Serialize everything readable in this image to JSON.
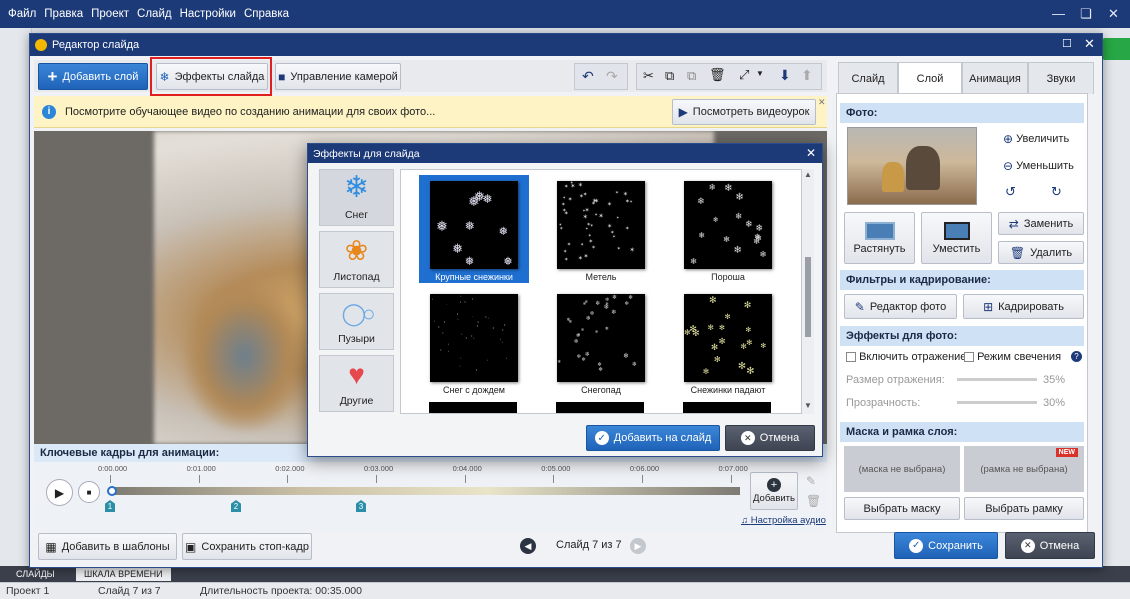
{
  "menubar": [
    "Файл",
    "Правка",
    "Проект",
    "Слайд",
    "Настройки",
    "Справка"
  ],
  "dialog": {
    "title": "Редактор слайда",
    "toolbar": {
      "add_layer": "Добавить слой",
      "slide_effects": "Эффекты слайда",
      "camera": "Управление камерой"
    },
    "hint": {
      "text": "Посмотрите обучающее видео по созданию анимации для своих фото...",
      "button": "Посмотреть видеоурок"
    },
    "timeline": {
      "header": "Ключевые кадры для анимации:",
      "ticks": [
        "0:00.000",
        "0:01.000",
        "0:02.000",
        "0:03.000",
        "0:04.000",
        "0:05.000",
        "0:06.000",
        "0:07.000"
      ],
      "keyframes": [
        "1",
        "2",
        "3"
      ],
      "add_label": "Добавить",
      "audio_link": "Настройка аудио"
    },
    "bottom": {
      "add_templates": "Добавить в шаблоны",
      "save_frame": "Сохранить стоп-кадр",
      "slide_counter": "Слайд 7 из 7",
      "save": "Сохранить",
      "cancel": "Отмена"
    }
  },
  "right_panel": {
    "tabs": [
      "Слайд",
      "Слой",
      "Анимация",
      "Звуки"
    ],
    "active_tab": "Слой",
    "photo_header": "Фото:",
    "zoom_in": "Увеличить",
    "zoom_out": "Уменьшить",
    "stretch": "Растянуть",
    "fit": "Уместить",
    "replace": "Заменить",
    "delete": "Удалить",
    "filters_header": "Фильтры и кадрирование:",
    "photo_editor": "Редактор фото",
    "crop": "Кадрировать",
    "effects_header": "Эффекты для фото:",
    "reflection": "Включить отражение",
    "glow": "Режим свечения",
    "reflection_size_label": "Размер отражения:",
    "reflection_size_value": "35%",
    "transparency_label": "Прозрачность:",
    "transparency_value": "30%",
    "mask_header": "Маска и рамка слоя:",
    "mask_none": "(маска не выбрана)",
    "frame_none": "(рамка не выбрана)",
    "new_badge": "NEW",
    "choose_mask": "Выбрать маску",
    "choose_frame": "Выбрать рамку"
  },
  "effects_popup": {
    "title": "Эффекты для слайда",
    "categories": [
      "Снег",
      "Листопад",
      "Пузыри",
      "Другие"
    ],
    "tiles": [
      "Крупные снежинки",
      "Метель",
      "Пороша",
      "Снег с дождем",
      "Снегопад",
      "Снежинки падают"
    ],
    "selected_tile": "Крупные снежинки",
    "add_button": "Добавить на слайд",
    "cancel_button": "Отмена"
  },
  "bottom_tabs": [
    "СЛАЙДЫ",
    "ШКАЛА ВРЕМЕНИ"
  ],
  "status": {
    "project": "Проект 1",
    "slide": "Слайд 7 из 7",
    "duration": "Длительность проекта: 00:35.000"
  },
  "colors": {
    "title_bar": "#1c3a78",
    "accent": "#1f63b8",
    "highlight": "#e02020",
    "hint_bg": "#fdf3c4"
  }
}
